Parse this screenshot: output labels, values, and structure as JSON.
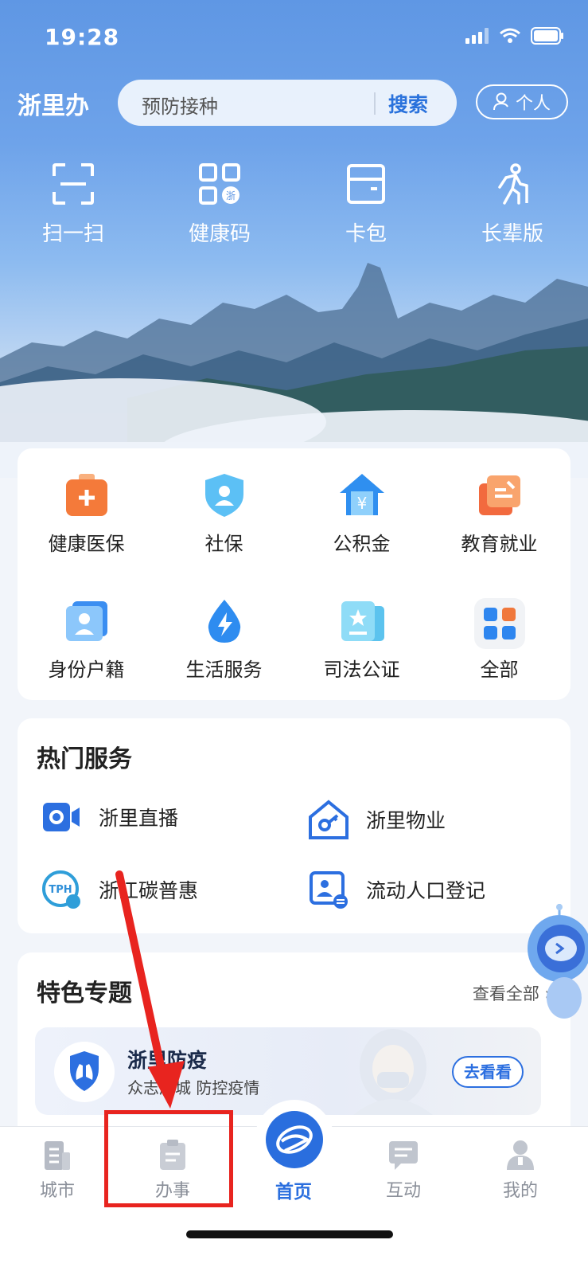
{
  "status": {
    "time": "19:28"
  },
  "header": {
    "logo": "浙里办",
    "search_placeholder": "预防接种",
    "search_button": "搜索",
    "personal": "个人"
  },
  "quick_actions": [
    {
      "label": "扫一扫",
      "icon": "scan-icon"
    },
    {
      "label": "健康码",
      "icon": "health-code-icon",
      "badge": "浙"
    },
    {
      "label": "卡包",
      "icon": "card-wallet-icon"
    },
    {
      "label": "长辈版",
      "icon": "elder-mode-icon"
    }
  ],
  "services": [
    {
      "label": "健康医保",
      "icon": "medical-kit-icon",
      "color": "#f47a3a"
    },
    {
      "label": "社保",
      "icon": "social-security-icon",
      "color": "#3aa6ef"
    },
    {
      "label": "公积金",
      "icon": "housing-fund-icon",
      "color": "#2f8ff0"
    },
    {
      "label": "教育就业",
      "icon": "education-icon",
      "color": "#f26a3e"
    },
    {
      "label": "身份户籍",
      "icon": "id-card-icon",
      "color": "#3b8ef1"
    },
    {
      "label": "生活服务",
      "icon": "water-bolt-icon",
      "color": "#2e8cf0"
    },
    {
      "label": "司法公证",
      "icon": "notary-icon",
      "color": "#39b5ea"
    },
    {
      "label": "全部",
      "icon": "all-apps-icon",
      "color": "#2e86ef"
    }
  ],
  "hot": {
    "title": "热门服务",
    "items": [
      {
        "label": "浙里直播",
        "icon": "live-camera-icon"
      },
      {
        "label": "浙里物业",
        "icon": "property-key-icon"
      },
      {
        "label": "浙江碳普惠",
        "icon": "tph-carbon-icon",
        "badge": "TPH"
      },
      {
        "label": "流动人口登记",
        "icon": "population-register-icon"
      }
    ]
  },
  "featured": {
    "title": "特色专题",
    "see_all": "查看全部",
    "banner_title": "浙里防疫",
    "banner_subtitle": "众志成城 防控疫情",
    "banner_button": "去看看"
  },
  "tabbar": [
    {
      "label": "城市"
    },
    {
      "label": "办事"
    },
    {
      "label": "首页"
    },
    {
      "label": "互动"
    },
    {
      "label": "我的"
    }
  ],
  "colors": {
    "accent": "#2a72dc",
    "annotation": "#e8241f"
  }
}
